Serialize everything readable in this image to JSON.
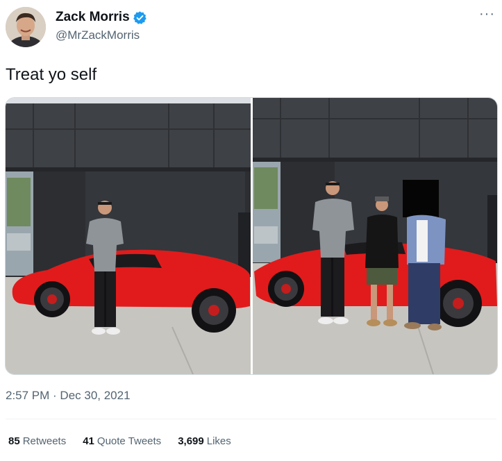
{
  "author": {
    "display_name": "Zack Morris",
    "handle": "@MrZackMorris",
    "verified": true,
    "verified_color": "#1d9bf0"
  },
  "more_icon": "···",
  "tweet": {
    "text": "Treat yo self",
    "timestamp": "2:57 PM · Dec 30, 2021"
  },
  "media": [
    {
      "name": "Photo of man standing beside red Ferrari"
    },
    {
      "name": "Photo of three people standing beside red Ferrari"
    }
  ],
  "stats": {
    "retweets_count": "85",
    "retweets_label": "Retweets",
    "quotes_count": "41",
    "quotes_label": "Quote Tweets",
    "likes_count": "3,699",
    "likes_label": "Likes"
  },
  "colors": {
    "text_primary": "#0f1419",
    "text_secondary": "#536471",
    "car_red": "#e11b1b",
    "building_gray": "#3a3d42"
  }
}
